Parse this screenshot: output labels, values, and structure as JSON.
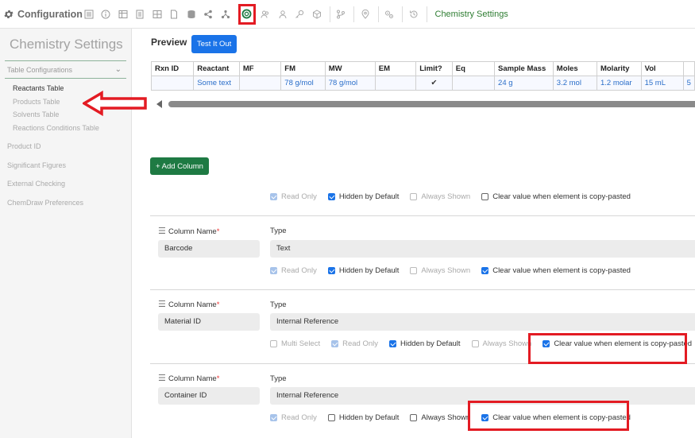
{
  "app": {
    "title": "Configuration",
    "breadcrumb": "Chemistry Settings"
  },
  "toolbar": {
    "icons": [
      "list-icon",
      "info-icon",
      "table-icon",
      "document-icon",
      "grid-icon",
      "file-icon",
      "database-icon",
      "share-icon",
      "network-icon",
      "chemistry-icon",
      "people-icon",
      "person-icon",
      "key-icon",
      "cube-icon",
      "branch-icon",
      "location-icon",
      "settings-icon",
      "history-icon"
    ]
  },
  "sidebar": {
    "title": "Chemistry Settings",
    "group_label": "Table Configurations",
    "group_items": [
      {
        "label": "Reactants Table",
        "active": true
      },
      {
        "label": "Products Table",
        "active": false
      },
      {
        "label": "Solvents Table",
        "active": false
      },
      {
        "label": "Reactions Conditions Table",
        "active": false
      }
    ],
    "links": [
      "Product ID",
      "Significant Figures",
      "External Checking",
      "ChemDraw Preferences"
    ]
  },
  "preview": {
    "title": "Preview",
    "test_button": "Test It Out",
    "columns": [
      "Rxn ID",
      "Reactant",
      "MF",
      "FM",
      "MW",
      "EM",
      "Limit?",
      "Eq",
      "Sample Mass",
      "Moles",
      "Molarity",
      "Vol",
      ""
    ],
    "row": [
      "",
      "Some text",
      "",
      "78 g/mol",
      "78 g/mol",
      "",
      "✔",
      "",
      "24 g",
      "3.2 mol",
      "1.2 molar",
      "15 mL",
      "5"
    ]
  },
  "add_column_button": "Add Column",
  "cards": [
    {
      "name_label": "Column Name",
      "name_value": "",
      "type_label": "Type",
      "type_value": "",
      "options": [
        {
          "label": "Read Only",
          "checked": true,
          "disabled": true
        },
        {
          "label": "Hidden by Default",
          "checked": true,
          "disabled": false
        },
        {
          "label": "Always Shown",
          "checked": false,
          "disabled": true
        },
        {
          "label": "Clear value when element is copy-pasted",
          "checked": false,
          "disabled": false
        }
      ]
    },
    {
      "name_label": "Column Name",
      "name_value": "Barcode",
      "type_label": "Type",
      "type_value": "Text",
      "options": [
        {
          "label": "Read Only",
          "checked": true,
          "disabled": true
        },
        {
          "label": "Hidden by Default",
          "checked": true,
          "disabled": false
        },
        {
          "label": "Always Shown",
          "checked": false,
          "disabled": true
        },
        {
          "label": "Clear value when element is copy-pasted",
          "checked": true,
          "disabled": false
        }
      ]
    },
    {
      "name_label": "Column Name",
      "name_value": "Material ID",
      "type_label": "Type",
      "type_value": "Internal Reference",
      "options": [
        {
          "label": "Multi Select",
          "checked": false,
          "disabled": true
        },
        {
          "label": "Read Only",
          "checked": true,
          "disabled": true
        },
        {
          "label": "Hidden by Default",
          "checked": true,
          "disabled": false
        },
        {
          "label": "Always Shown",
          "checked": false,
          "disabled": true
        },
        {
          "label": "Clear value when element is copy-pasted",
          "checked": true,
          "disabled": false
        }
      ]
    },
    {
      "name_label": "Column Name",
      "name_value": "Container ID",
      "type_label": "Type",
      "type_value": "Internal Reference",
      "options": [
        {
          "label": "Read Only",
          "checked": true,
          "disabled": true
        },
        {
          "label": "Hidden by Default",
          "checked": false,
          "disabled": false
        },
        {
          "label": "Always Shown",
          "checked": false,
          "disabled": false
        },
        {
          "label": "Clear value when element is copy-pasted",
          "checked": true,
          "disabled": false
        }
      ]
    }
  ],
  "colors": {
    "accent": "#1a73e8",
    "brand_green": "#2e7d32",
    "add_button": "#1e7a43",
    "annotation_red": "#e31b23"
  }
}
